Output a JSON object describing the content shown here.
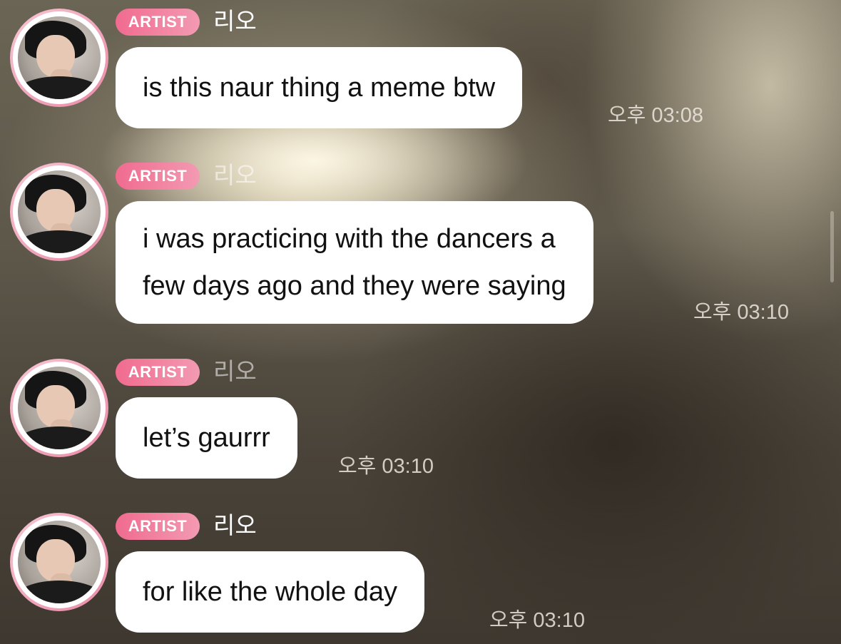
{
  "messages": [
    {
      "badge": "ARTIST",
      "name": "리오",
      "text_lines": [
        "is this naur thing a meme btw"
      ],
      "time": "오후 03:08"
    },
    {
      "badge": "ARTIST",
      "name": "리오",
      "text_lines": [
        "i was practicing with the dancers a",
        "few days ago and they were saying"
      ],
      "time": "오후 03:10"
    },
    {
      "badge": "ARTIST",
      "name": "리오",
      "text_lines": [
        "let’s gaurrr"
      ],
      "time": "오후 03:10"
    },
    {
      "badge": "ARTIST",
      "name": "리오",
      "text_lines": [
        "for like the whole day"
      ],
      "time": "오후 03:10"
    }
  ],
  "colors": {
    "badge": "#f06b8f",
    "avatar_ring": "#ea8aa6",
    "bubble": "#ffffff",
    "bubble_text": "#111111"
  },
  "icons": {
    "avatar": "artist-profile-photo"
  }
}
